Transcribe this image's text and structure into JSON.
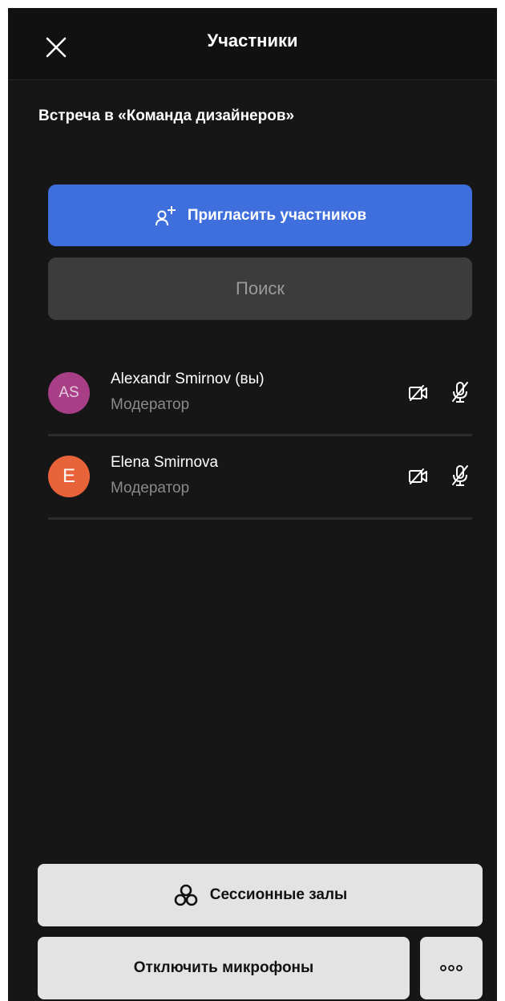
{
  "header": {
    "title": "Участники",
    "close_icon": "close-icon"
  },
  "meeting": {
    "title": "Встреча в «Команда дизайнеров»"
  },
  "invite": {
    "label": "Пригласить участников",
    "icon": "add-user-icon",
    "color": "#3e6fdd"
  },
  "search": {
    "placeholder": "Поиск",
    "value": ""
  },
  "participants": [
    {
      "initials": "AS",
      "name": "Alexandr Smirnov (вы)",
      "role": "Модератор",
      "avatar_color": "#a83f86",
      "camera_icon": "camera-off-icon",
      "mic_icon": "mic-off-icon"
    },
    {
      "initials": "E",
      "name": "Elena Smirnova",
      "role": "Модератор",
      "avatar_color": "#e8623a",
      "camera_icon": "camera-off-icon",
      "mic_icon": "mic-off-icon"
    }
  ],
  "footer": {
    "breakout_label": "Сессионные залы",
    "breakout_icon": "breakout-rooms-icon",
    "mute_all_label": "Отключить микрофоны",
    "more_icon": "more-icon"
  },
  "colors": {
    "background": "#161616",
    "header_bg": "#111111",
    "secondary_text": "#8a8a8a"
  }
}
